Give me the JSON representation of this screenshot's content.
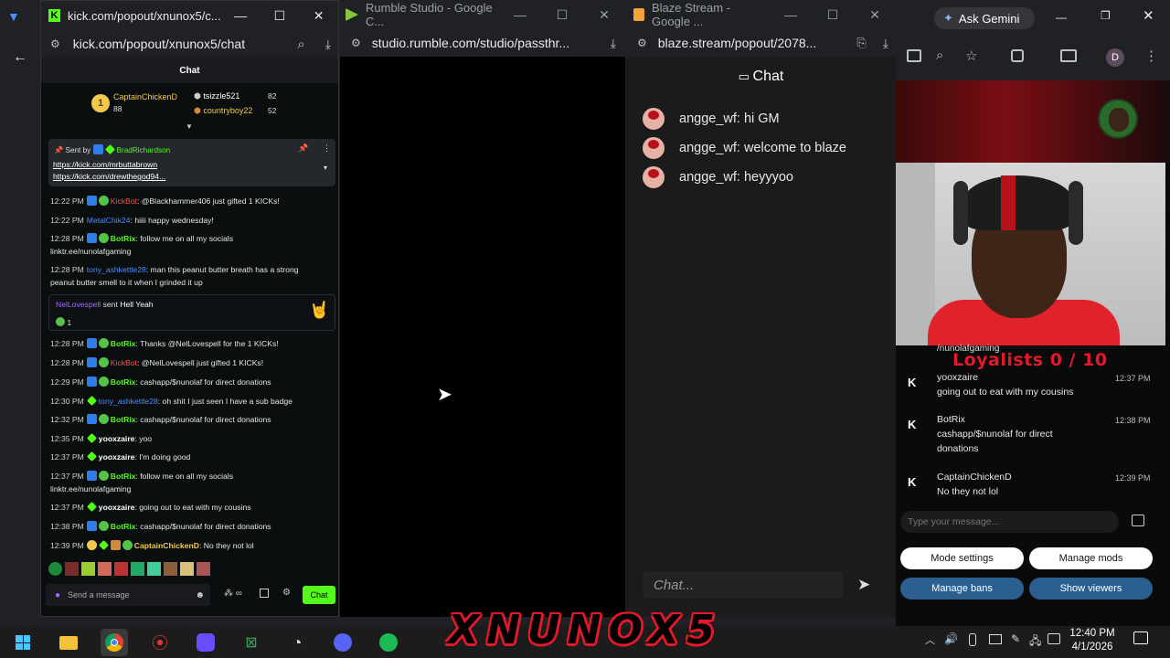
{
  "kick_window": {
    "title": "kick.com/popout/xnunox5/c...",
    "url": "kick.com/popout/xnunox5/chat",
    "chat_header": "Chat",
    "leaderboard": {
      "first": {
        "name": "CaptainChickenD",
        "points": "88"
      },
      "second": {
        "name": "tsizzle521",
        "points": "82"
      },
      "third": {
        "name": "countryboy22",
        "points": "52"
      }
    },
    "pinned": {
      "label": "Sent by",
      "sender": "BradRichardson",
      "link1": "https://kick.com/mrbuttabrown",
      "link2": "https://kick.com/drewthegod94..."
    },
    "messages": [
      {
        "time": "12:22 PM",
        "user": "KickBot",
        "text": ": @Blackhammer406 just gifted 1 KICKs!"
      },
      {
        "time": "12:22 PM",
        "user": "MetalChik24",
        "text": ": hiiii happy wednesday!"
      },
      {
        "time": "12:28 PM",
        "user": "BotRix",
        "text": ": follow me on all my socials",
        "text2": "linktr.ee/nunolafgaming"
      },
      {
        "time": "12:28 PM",
        "user": "tony_ashkettle28",
        "text": ": man this peanut butter breath has a strong",
        "text2": "peanut butter smell to it when I grinded it up"
      },
      {
        "time": "12:28 PM",
        "user": "BotRix",
        "text": ": Thanks @NelLovespell for the 1 KICKs!"
      },
      {
        "time": "12:28 PM",
        "user": "KickBot",
        "text": ": @NelLovespell just gifted 1 KICKs!"
      },
      {
        "time": "12:29 PM",
        "user": "BotRix",
        "text": ": cashapp/$nunolaf for direct donations"
      },
      {
        "time": "12:30 PM",
        "user": "tony_ashkettle28",
        "text": ": oh shit I just seen I have a sub badge"
      },
      {
        "time": "12:32 PM",
        "user": "BotRix",
        "text": ": cashapp/$nunolaf for direct donations"
      },
      {
        "time": "12:35 PM",
        "user": "yooxzaire",
        "text": ": yoo"
      },
      {
        "time": "12:37 PM",
        "user": "yooxzaire",
        "text": ": I'm doing good"
      },
      {
        "time": "12:37 PM",
        "user": "BotRix",
        "text": ": follow me on all my socials",
        "text2": "linktr.ee/nunolafgaming"
      },
      {
        "time": "12:37 PM",
        "user": "yooxzaire",
        "text": ": going out to eat with my cousins"
      },
      {
        "time": "12:38 PM",
        "user": "BotRix",
        "text": ": cashapp/$nunolaf for direct donations"
      },
      {
        "time": "12:39 PM",
        "user": "CaptainChickenD",
        "text": ": No they not lol"
      }
    ],
    "gift": {
      "user": "NelLovespell",
      "sent": "sent",
      "item": "Hell Yeah",
      "count": "1"
    },
    "send_placeholder": "Send a message",
    "chat_button": "Chat"
  },
  "rumble_window": {
    "title": "Rumble Studio - Google C...",
    "url": "studio.rumble.com/studio/passthr..."
  },
  "blaze_window": {
    "title": "Blaze Stream - Google ...",
    "url": "blaze.stream/popout/2078...",
    "chat_header": "Chat",
    "messages": [
      {
        "user": "angge_wf",
        "text": ": hi GM"
      },
      {
        "user": "angge_wf",
        "text": ": welcome to blaze"
      },
      {
        "user": "angge_wf",
        "text": ": heyyyoo"
      }
    ],
    "input_placeholder": "Chat..."
  },
  "right_panel": {
    "ask_gemini": "Ask Gemini",
    "profile_initial": "D",
    "overlay_handle": "/nunolafgaming",
    "loyalists": "Loyalists  0 / 10",
    "messages": [
      {
        "user": "yooxzaire",
        "text": "going out to eat with my cousins",
        "time": "12:37 PM"
      },
      {
        "user": "BotRix",
        "text": "cashapp/$nunolaf for direct",
        "text2": "donations",
        "time": "12:38 PM"
      },
      {
        "user": "CaptainChickenD",
        "text": "No they not lol",
        "time": "12:39 PM"
      }
    ],
    "input_placeholder": "Type your message...",
    "buttons": {
      "mode_settings": "Mode settings",
      "manage_mods": "Manage mods",
      "manage_bans": "Manage bans",
      "show_viewers": "Show viewers"
    }
  },
  "overlay_title": "XNUNOX5",
  "taskbar": {
    "time": "12:40 PM",
    "date": "4/1/2026"
  },
  "colors": {
    "kick_green": "#53fc18",
    "botrix_green": "#53c449",
    "kickbot_red": "#ff4d4d",
    "user_blue": "#4d8cff",
    "loyalist_red": "#e3192b"
  }
}
